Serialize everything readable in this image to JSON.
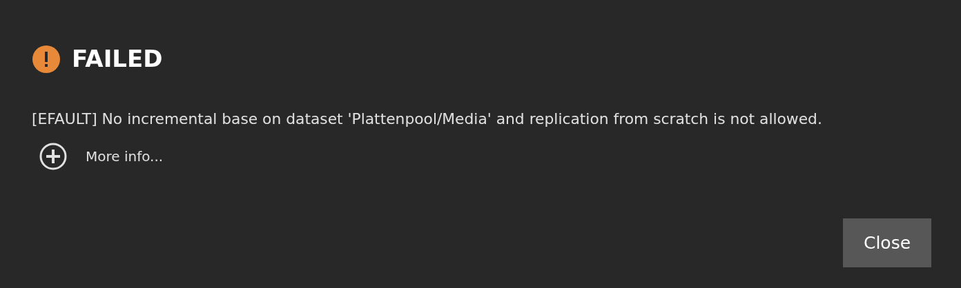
{
  "dialog": {
    "title": "FAILED",
    "message": "[EFAULT] No incremental base on dataset 'Plattenpool/Media' and replication from scratch is not allowed.",
    "more_info": {
      "label": "More info...",
      "expanded": false
    },
    "buttons": [
      "Close"
    ]
  }
}
